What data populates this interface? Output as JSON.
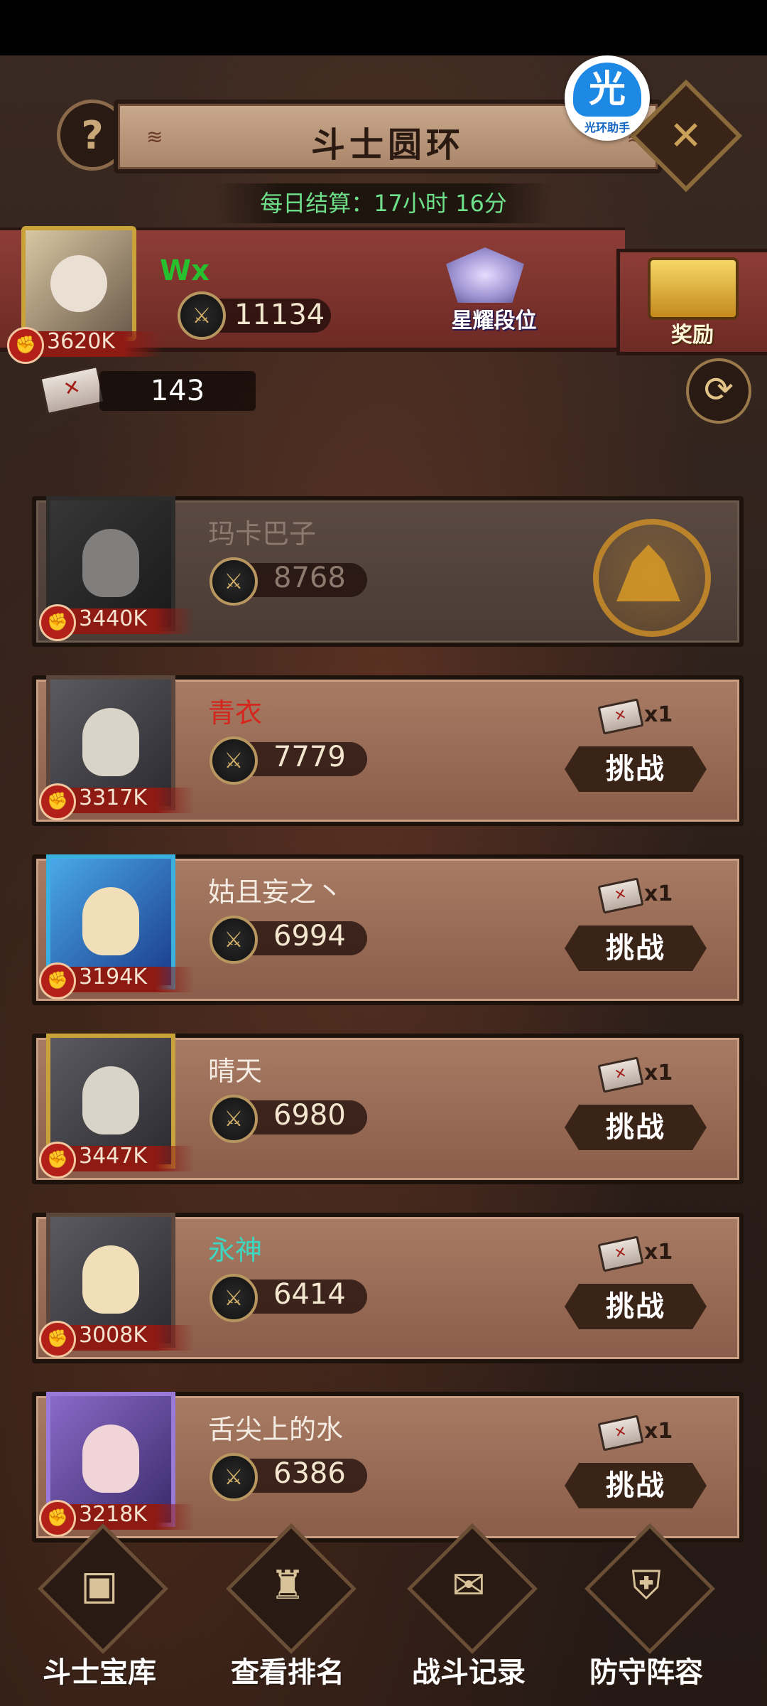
{
  "header": {
    "title": "斗士圆环",
    "help_icon": "?",
    "close_icon": "✕"
  },
  "watermark": {
    "glyph": "光",
    "label": "光环助手"
  },
  "daily_settlement": "每日结算：17小时 16分",
  "player": {
    "name": "Wx",
    "score": "11134",
    "power": "3620K",
    "rank_label": "星耀段位",
    "reward_label": "奖励",
    "tickets": "143"
  },
  "opponents": [
    {
      "name": "玛卡巴子",
      "name_color": "#8d7a6e",
      "score": "8768",
      "power": "3440K",
      "defeated": true
    },
    {
      "name": "青衣",
      "name_color": "#d4261c",
      "score": "7779",
      "power": "3317K",
      "ticket_cost": "x1",
      "challenge": "挑战"
    },
    {
      "name": "姑且妄之丶",
      "name_color": "#f4ece2",
      "score": "6994",
      "power": "3194K",
      "ticket_cost": "x1",
      "challenge": "挑战"
    },
    {
      "name": "晴天",
      "name_color": "#f4ece2",
      "score": "6980",
      "power": "3447K",
      "ticket_cost": "x1",
      "challenge": "挑战"
    },
    {
      "name": "永神",
      "name_color": "#3fd6c0",
      "score": "6414",
      "power": "3008K",
      "ticket_cost": "x1",
      "challenge": "挑战"
    },
    {
      "name": "舌尖上的水",
      "name_color": "#f4ece2",
      "score": "6386",
      "power": "3218K",
      "ticket_cost": "x1",
      "challenge": "挑战"
    }
  ],
  "bottom_nav": [
    {
      "label": "斗士宝库",
      "icon": "treasure-chest-icon"
    },
    {
      "label": "查看排名",
      "icon": "trophy-icon"
    },
    {
      "label": "战斗记录",
      "icon": "scroll-icon"
    },
    {
      "label": "防守阵容",
      "icon": "shield-icon"
    }
  ]
}
